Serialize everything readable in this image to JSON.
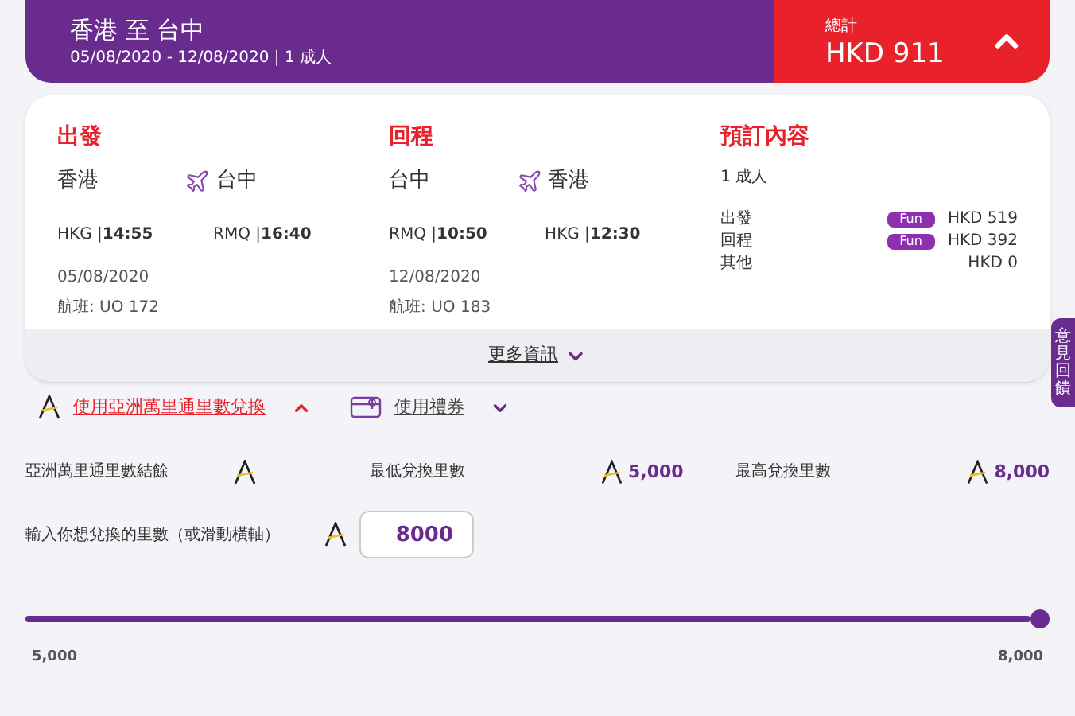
{
  "summary": {
    "route": "香港 至 台中",
    "details": "05/08/2020 - 12/08/2020 | 1 成人",
    "total_label": "總計",
    "total": "HKD 911",
    "expanded": true
  },
  "legs": [
    {
      "title": "出發",
      "from": "香港",
      "to": "台中",
      "dep_code": "HKG |",
      "dep_time": "14:55",
      "arr_code": "RMQ |",
      "arr_time": "16:40",
      "date": "05/08/2020",
      "flight": "航班: UO 172"
    },
    {
      "title": "回程",
      "from": "台中",
      "to": "香港",
      "dep_code": "RMQ |",
      "dep_time": "10:50",
      "arr_code": "HKG |",
      "arr_time": "12:30",
      "date": "12/08/2020",
      "flight": "航班: UO 183"
    }
  ],
  "booking": {
    "title": "預訂內容",
    "passengers": "1 成人",
    "lines": [
      {
        "label": "出發",
        "badge": "Fun",
        "amount": "HKD 519"
      },
      {
        "label": "回程",
        "badge": "Fun",
        "amount": "HKD 392"
      },
      {
        "label": "其他",
        "amount": "HKD 0"
      }
    ]
  },
  "more_info": "更多資訊",
  "feedback_tab": "意見回饋",
  "payment_tabs": [
    {
      "label": "使用亞洲萬里通里數兌換",
      "kind": "miles",
      "selected": true
    },
    {
      "label": "使用禮券",
      "kind": "voucher",
      "selected": false
    }
  ],
  "miles": {
    "balance_label": "亞洲萬里通里數結餘",
    "min_label": "最低兌換里數",
    "min_value": "5,000",
    "max_label": "最高兌換里數",
    "max_value": "8,000",
    "input_label": "輸入你想兌換的里數（或滑動橫軸）",
    "input_value": "8000",
    "slider": {
      "level": 1,
      "min": "5,000",
      "max": "8,000"
    }
  }
}
